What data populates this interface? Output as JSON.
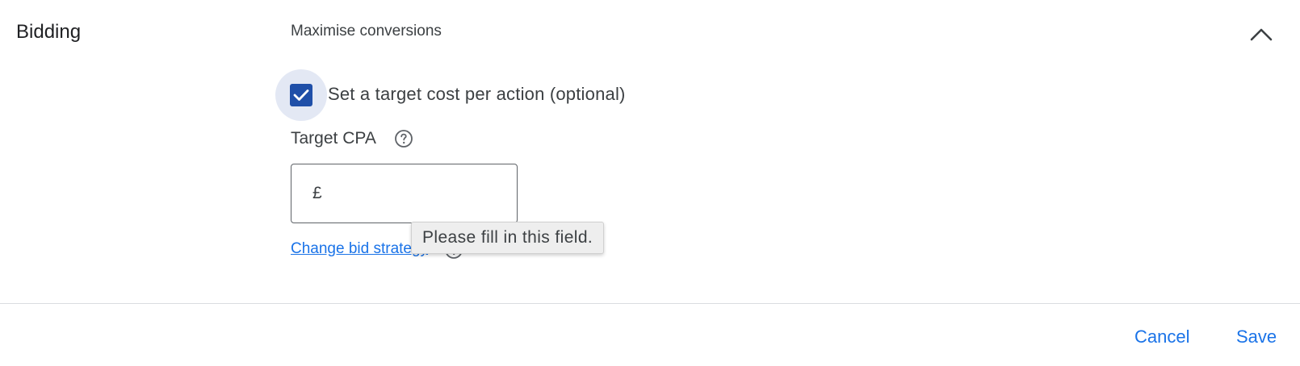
{
  "section": {
    "title": "Bidding",
    "strategy": "Maximise conversions"
  },
  "target_cpa_option": {
    "checked": true,
    "label": "Set a target cost per action (optional)"
  },
  "target_cpa": {
    "label": "Target CPA",
    "currency": "£",
    "value": ""
  },
  "links": {
    "change_bid_strategy": "Change bid strategy"
  },
  "validation": {
    "tooltip": "Please fill in this field."
  },
  "footer": {
    "cancel_label": "Cancel",
    "save_label": "Save"
  },
  "icons": {
    "collapse": "chevron-up-icon",
    "checkbox": "checkmark-icon",
    "help": "help-circle-icon"
  },
  "colors": {
    "accent": "#1a73e8",
    "checkbox_fill": "#1f4fa8",
    "checkbox_halo": "#e3e8f4"
  }
}
